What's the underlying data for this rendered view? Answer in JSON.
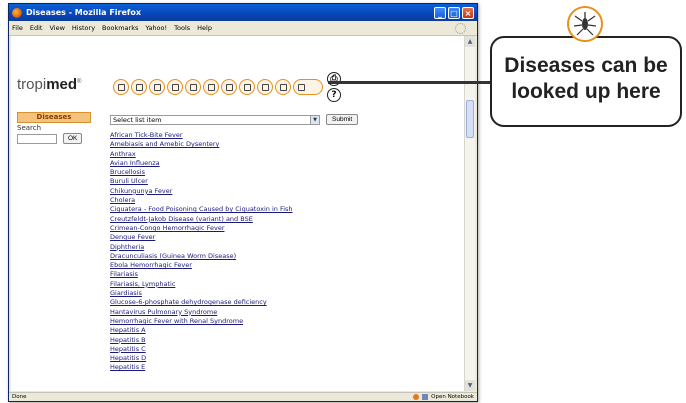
{
  "window": {
    "title": "Diseases - Mozilla Firefox",
    "status_text": "Done",
    "status_right": "Open Notebook"
  },
  "menu": [
    "File",
    "Edit",
    "View",
    "History",
    "Bookmarks",
    "Yahoo!",
    "Tools",
    "Help"
  ],
  "logo": {
    "text_plain": "tropi",
    "text_bold": "med",
    "mark": "®"
  },
  "sidebar": {
    "heading": "Diseases",
    "search_label": "Search",
    "ok_label": "OK"
  },
  "selector": {
    "selected": "Select list item",
    "submit_label": "Submit"
  },
  "diseases": [
    "African Tick-Bite Fever",
    "Amebiasis and Amebic Dysentery",
    "Anthrax",
    "Avian Influenza",
    "Brucellosis",
    "Buruli Ulcer",
    "Chikungunya Fever",
    "Cholera",
    "Ciguatera - Food Poisoning Caused by Ciguatoxin in Fish",
    "Creutzfeldt-Jakob Disease (variant) and BSE",
    "Crimean-Congo Hemorrhagic Fever",
    "Dengue Fever",
    "Diphtheria",
    "Dracunculiasis (Guinea Worm Disease)",
    "Ebola Hemorrhagic Fever",
    "Filariasis",
    "Filariasis, Lymphatic",
    "Giardiasis",
    "Glucose-6-phosphate dehydrogenase deficiency",
    "Hantavirus Pulmonary Syndrome",
    "Hemorrhagic Fever with Renal Syndrome",
    "Hepatitis A",
    "Hepatitis B",
    "Hepatitis C",
    "Hepatitis D",
    "Hepatitis E"
  ],
  "help_icon": "?",
  "callout": {
    "line1": "Diseases can be",
    "line2": "looked up here"
  },
  "colors": {
    "accent_orange": "#e8901c",
    "titlebar_blue": "#0a5fd8",
    "link": "#1a1a7a"
  }
}
